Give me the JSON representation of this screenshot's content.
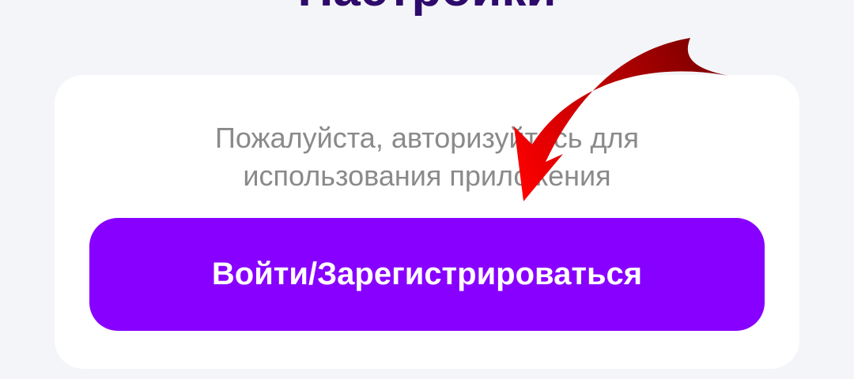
{
  "header": {
    "title": "Настройки"
  },
  "auth_card": {
    "message_line1": "Пожалуйста, авторизуйтесь для",
    "message_line2": "использования приложения",
    "login_button_label": "Войти/Зарегистрироваться"
  },
  "annotation": {
    "icon": "arrow-pointer-icon",
    "color": "#e00000"
  },
  "colors": {
    "accent": "#8800ff",
    "title": "#2d0a6b",
    "background": "#f4f5f9"
  }
}
